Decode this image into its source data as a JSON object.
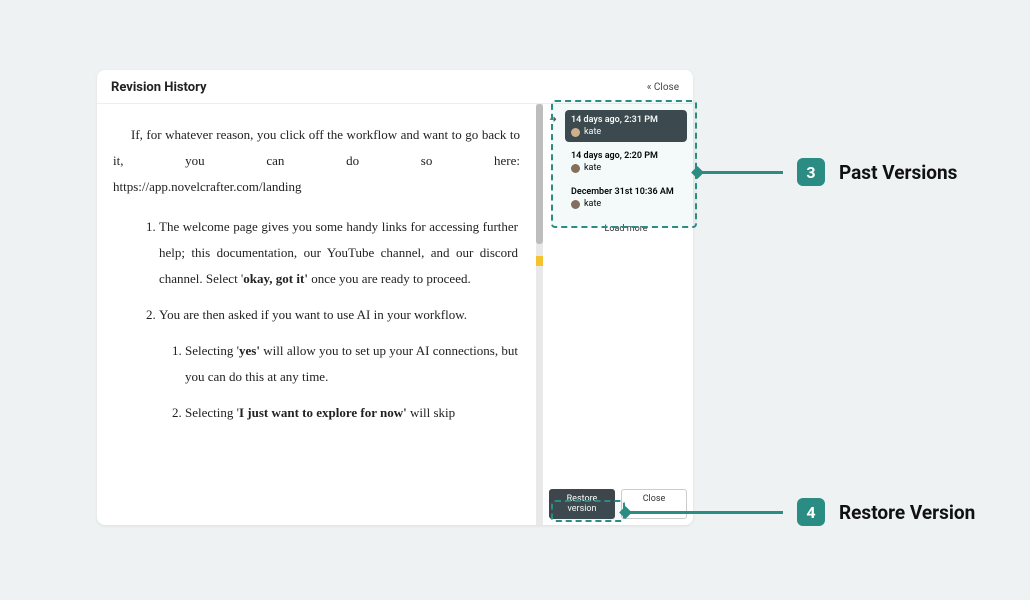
{
  "header": {
    "title": "Revision History",
    "close": "« Close"
  },
  "content": {
    "intro_part1": "If, for whatever reason, you click off the workflow and want to go back to it, you can do so here:",
    "intro_part2": "https://app.novelcrafter.com/landing",
    "list1_a": "The welcome page gives you some handy links for accessing further help; this documentation, our YouTube channel, and our discord channel. Select '",
    "list1_b": "okay, got it'",
    "list1_c": " once you are ready to proceed.",
    "list2": "You are then asked if you want to use AI in your workflow.",
    "sub1_a": "Selecting '",
    "sub1_b": "yes'",
    "sub1_c": " will allow you to set up your AI connections, but you can do this at any time.",
    "sub2_a": "Selecting '",
    "sub2_b": "I just want to explore for now'",
    "sub2_c": " will skip"
  },
  "versions": [
    {
      "time": "14 days ago, 2:31 PM",
      "user": "kate",
      "selected": true
    },
    {
      "time": "14 days ago, 2:20 PM",
      "user": "kate",
      "selected": false
    },
    {
      "time": "December 31st 10:36 AM",
      "user": "kate",
      "selected": false
    }
  ],
  "load_more": "Load more",
  "buttons": {
    "restore": "Restore version",
    "close": "Close"
  },
  "annotations": {
    "n3": "3",
    "label3": "Past Versions",
    "n4": "4",
    "label4": "Restore Version"
  }
}
